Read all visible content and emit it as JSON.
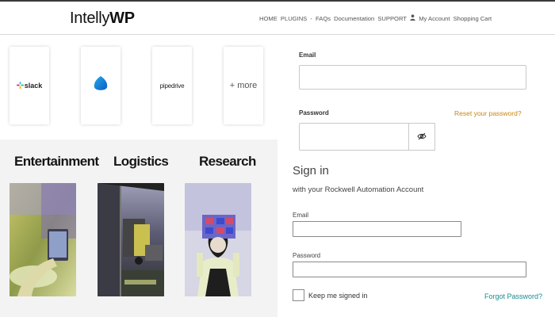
{
  "header": {
    "logo_regular": "Intelly",
    "logo_bold": "WP",
    "nav_items": [
      "HOME",
      "PLUGINS",
      "-",
      "FAQs",
      "Documentation",
      "SUPPORT",
      "My Account",
      "Shopping Cart"
    ]
  },
  "integrations": {
    "cards": [
      "slack",
      "",
      "pipedrive",
      "+ more"
    ]
  },
  "industries": {
    "items": [
      "Entertainment",
      "Logistics",
      "Research"
    ]
  },
  "login_form": {
    "email_label": "Email",
    "email_value": "",
    "password_label": "Password",
    "password_value": "",
    "reset_link": "Reset your password?"
  },
  "signin": {
    "title": "Sign in",
    "subtitle": "with your Rockwell Automation Account",
    "email_label": "Email",
    "email_value": "",
    "password_label": "Password",
    "password_value": "",
    "keep_signed_in": "Keep me signed in",
    "forgot_link": "Forgot Password?"
  },
  "colors": {
    "reset_link": "#c8880f",
    "forgot_link": "#1b8a8f",
    "industries_bg": "#f3f3f3"
  }
}
